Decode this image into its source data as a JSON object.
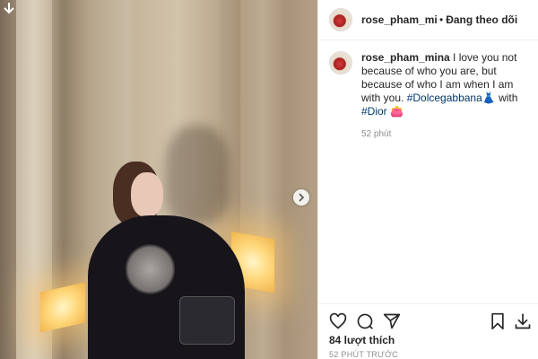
{
  "post": {
    "username_header": "rose_pham_mina",
    "dot": "•",
    "follow_label": "Đang theo dõi",
    "username_comment": "rose_pham_mina",
    "caption_text_1": " I love you not because of who you are, but because of who I am when I am with you. ",
    "hashtag_1": "#Dolcegabbana",
    "emoji_1": "👗",
    "caption_text_2": " with ",
    "hashtag_2": "#Dior",
    "emoji_2": "👛",
    "comment_time": "52 phút",
    "likes": "84 lượt thích",
    "posted_ago": "52 PHÚT TRƯỚC"
  },
  "icons": {
    "download": "download-arrow-icon",
    "next": "chevron-right-icon",
    "like": "heart-icon",
    "comment": "comment-bubble-icon",
    "share": "paper-plane-icon",
    "save": "bookmark-icon",
    "download_action": "download-tray-icon"
  },
  "colors": {
    "link": "#00376b",
    "text": "#262626",
    "muted": "#8e8e8e"
  }
}
